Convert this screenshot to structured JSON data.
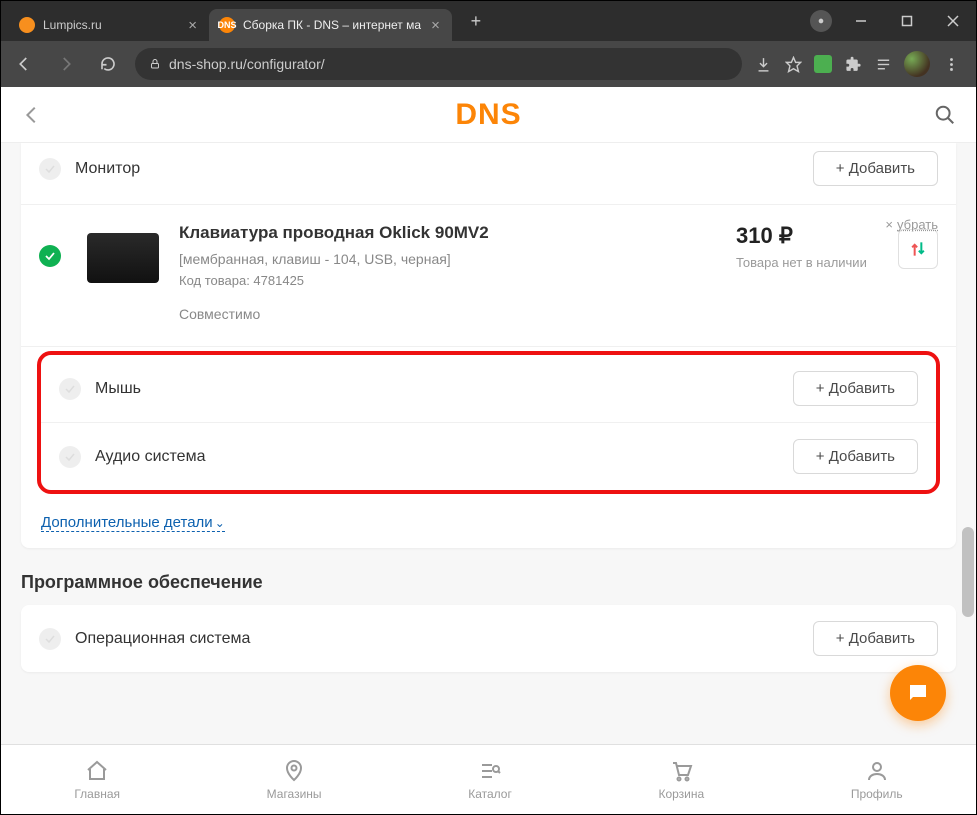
{
  "browser": {
    "tabs": [
      {
        "title": "Lumpics.ru",
        "favicon_bg": "#f78f1e"
      },
      {
        "title": "Сборка ПК - DNS – интернет ма",
        "favicon_bg": "#fc8507",
        "favicon_text": "DNS"
      }
    ],
    "url": "dns-shop.ru/configurator/"
  },
  "header": {
    "logo": "DNS"
  },
  "rows": {
    "monitor": {
      "label": "Монитор",
      "btn": "+ Добавить"
    },
    "mouse": {
      "label": "Мышь",
      "btn": "+ Добавить"
    },
    "audio": {
      "label": "Аудио система",
      "btn": "+ Добавить"
    },
    "os": {
      "label": "Операционная система",
      "btn": "+ Добавить"
    }
  },
  "product": {
    "title": "Клавиатура проводная Oklick 90MV2",
    "spec": "[мембранная, клавиш - 104, USB, черная]",
    "code": "Код товара: 4781425",
    "compat": "Совместимо",
    "price": "310 ₽",
    "stock": "Товара нет в наличии",
    "remove": "убрать"
  },
  "links": {
    "extra": "Дополнительные детали"
  },
  "sections": {
    "software": "Программное обеспечение"
  },
  "nav": {
    "home": "Главная",
    "shops": "Магазины",
    "catalog": "Каталог",
    "cart": "Корзина",
    "profile": "Профиль"
  }
}
